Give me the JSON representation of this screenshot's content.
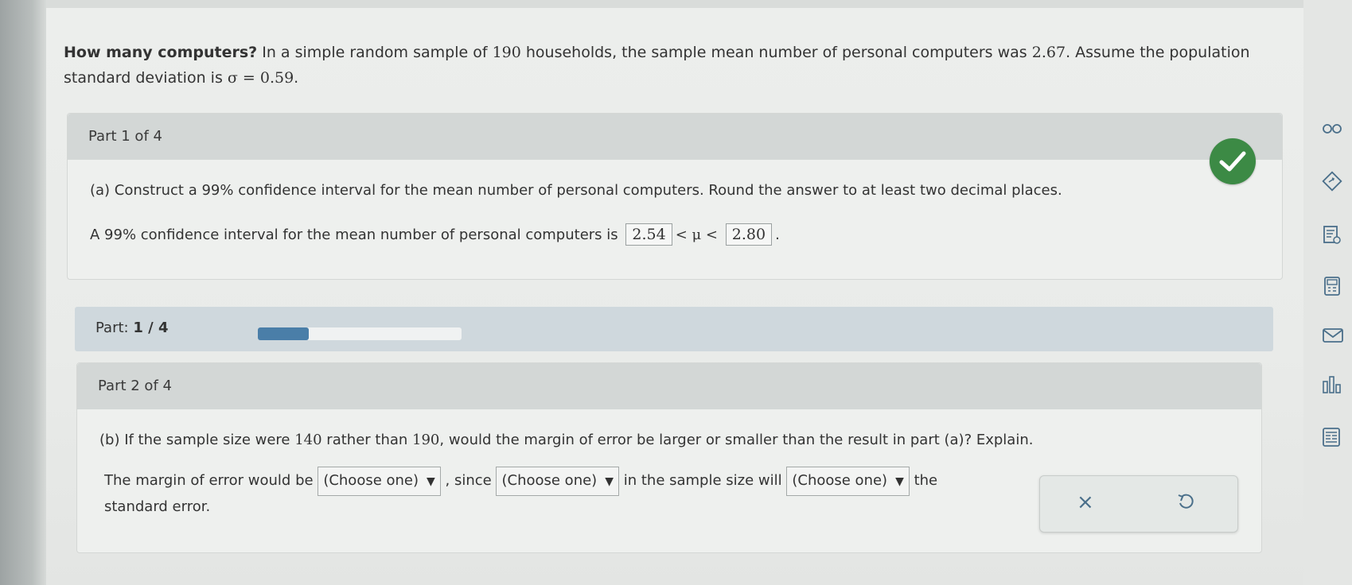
{
  "question": {
    "bold_title": "How many computers?",
    "text_pre": " In a simple random sample of ",
    "n": "190",
    "text_mid": " households, the sample mean number of personal computers was ",
    "mean": "2.67",
    "text_post": ". Assume the population standard deviation is ",
    "sigma": "σ = 0.59",
    "end": "."
  },
  "part1": {
    "header": "Part 1 of 4",
    "prompt": "(a) Construct a 99% confidence interval for the mean number of personal computers. Round the answer to at least two decimal places.",
    "answer_pre": "A 99% confidence interval for the mean number of personal computers is",
    "lower": "2.54",
    "mu_expr": "< μ <",
    "upper": "2.80",
    "answer_end": "."
  },
  "progress": {
    "label": "Part:",
    "current": "1 / 4",
    "fraction": 0.25
  },
  "part2": {
    "header": "Part 2 of 4",
    "prompt_pre": "(b) If the sample size were ",
    "n_new": "140",
    "prompt_mid": " rather than ",
    "n_old": "190",
    "prompt_post": ", would the margin of error be larger or smaller than the result in part (a)? Explain.",
    "s1": "The margin of error would be",
    "dropdown1": "(Choose one)",
    "s2": ", since",
    "dropdown2": "(Choose one)",
    "s3": "in the sample size will",
    "dropdown3": "(Choose one)",
    "s4": "the",
    "s5": "standard error."
  },
  "actions": {
    "clear": "×"
  },
  "colors": {
    "check": "#3c8a45",
    "progress": "#4a7ea8"
  }
}
